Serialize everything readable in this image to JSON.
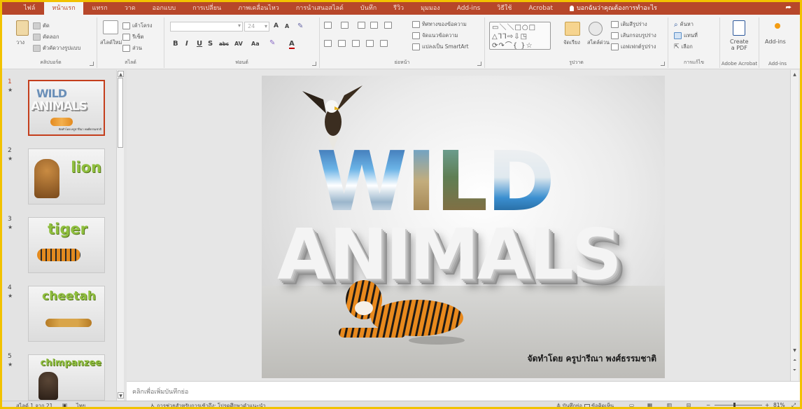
{
  "tabs": [
    {
      "label": "ไฟล์",
      "active": false
    },
    {
      "label": "หน้าแรก",
      "active": true
    },
    {
      "label": "แทรก",
      "active": false
    },
    {
      "label": "วาด",
      "active": false
    },
    {
      "label": "ออกแบบ",
      "active": false
    },
    {
      "label": "การเปลี่ยน",
      "active": false
    },
    {
      "label": "ภาพเคลื่อนไหว",
      "active": false
    },
    {
      "label": "การนำเสนอสไลด์",
      "active": false
    },
    {
      "label": "บันทึก",
      "active": false
    },
    {
      "label": "รีวิว",
      "active": false
    },
    {
      "label": "มุมมอง",
      "active": false
    },
    {
      "label": "Add-ins",
      "active": false
    },
    {
      "label": "วิธีใช้",
      "active": false
    },
    {
      "label": "Acrobat",
      "active": false
    }
  ],
  "tell_me": "บอกฉันว่าคุณต้องการทำอะไร",
  "ribbon": {
    "clipboard": {
      "label": "คลิปบอร์ด",
      "paste": "วาง",
      "cut": "ตัด",
      "copy": "คัดลอก",
      "format_painter": "ตัวคัดวางรูปแบบ"
    },
    "slides": {
      "label": "สไลด์",
      "new_slide": "สไลด์ใหม่",
      "layout": "เค้าโครง",
      "reset": "รีเซ็ต",
      "section": "ส่วน"
    },
    "font": {
      "label": "ฟอนต์",
      "font_name": "",
      "font_size": "24",
      "bold": "B",
      "italic": "I",
      "underline": "U",
      "shadow": "S",
      "strike": "abc",
      "spacing": "AV",
      "case": "Aa",
      "grow": "A",
      "shrink": "A"
    },
    "paragraph": {
      "label": "ย่อหน้า",
      "text_direction": "ทิศทางของข้อความ",
      "align_text": "จัดแนวข้อความ",
      "smartart": "แปลงเป็น SmartArt"
    },
    "drawing": {
      "label": "รูปวาด",
      "arrange": "จัดเรียง",
      "quick_styles": "สไตล์ด่วน",
      "shape_fill": "เติมสีรูปร่าง",
      "shape_outline": "เส้นกรอบรูปร่าง",
      "shape_effects": "เอฟเฟกต์รูปร่าง"
    },
    "editing": {
      "label": "การแก้ไข",
      "find": "ค้นหา",
      "replace": "แทนที่",
      "select": "เลือก"
    },
    "acrobat": {
      "label": "Adobe Acrobat",
      "create_pdf_1": "Create",
      "create_pdf_2": "a PDF"
    },
    "addins": {
      "label": "Add-ins",
      "button": "Add-ins"
    }
  },
  "thumbnails": [
    {
      "num": "1",
      "star": "★",
      "title": "WILD ANIMALS",
      "credit": "จัดทำโดย ครูปารีณา พงศ์ธรรมชาติ"
    },
    {
      "num": "2",
      "star": "★",
      "title": "lion"
    },
    {
      "num": "3",
      "star": "★",
      "title": "tiger"
    },
    {
      "num": "4",
      "star": "★",
      "title": "cheetah"
    },
    {
      "num": "5",
      "star": "★",
      "title": "chimpanzee"
    }
  ],
  "slide": {
    "wild": [
      "W",
      "I",
      "L",
      "D"
    ],
    "animals": "ANIMALS",
    "credit": "จัดทำโดย ครูปารีณา พงศ์ธรรมชาติ"
  },
  "notes_placeholder": "คลิกเพื่อเพิ่มบันทึกย่อ",
  "status": {
    "slide_count": "สไลด์ 1 จาก 21",
    "language": "ไทย",
    "accessibility": "การช่วยสำหรับการเข้าถึง: โปรดศึกษาคำแนะนำ",
    "notes": "บันทึกย่อ",
    "comments": "ข้อคิดเห็น",
    "zoom": "81%",
    "minus": "−",
    "plus": "+"
  },
  "colors": {
    "accent": "#b7472a",
    "selection": "#c43e1c",
    "thumb_title": "#8fbf3e"
  }
}
